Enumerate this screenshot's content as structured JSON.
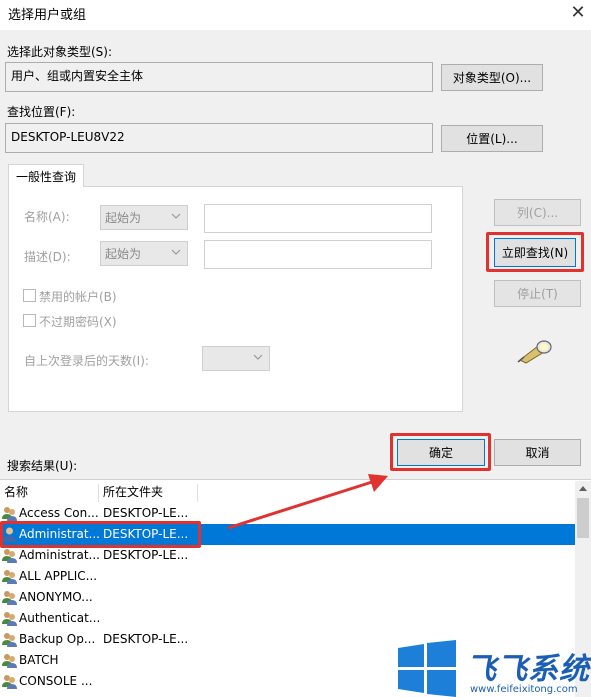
{
  "window": {
    "title": "选择用户或组",
    "close_glyph": "✕"
  },
  "object_type": {
    "label": "选择此对象类型(S):",
    "value": "用户、组或内置安全主体",
    "button": "对象类型(O)..."
  },
  "location": {
    "label": "查找位置(F):",
    "value": "DESKTOP-LEU8V22",
    "button": "位置(L)..."
  },
  "general_query": {
    "tab": "一般性查询",
    "name_label": "名称(A):",
    "name_combo": "起始为",
    "desc_label": "描述(D):",
    "desc_combo": "起始为",
    "disabled_accounts": "禁用的帐户(B)",
    "non_expiring_pwd": "不过期密码(X)",
    "days_since_logon": "自上次登录后的天数(I):"
  },
  "side_buttons": {
    "columns": "列(C)...",
    "find_now": "立即查找(N)",
    "stop": "停止(T)"
  },
  "dialog_buttons": {
    "ok": "确定",
    "cancel": "取消"
  },
  "results": {
    "label": "搜索结果(U):",
    "headers": [
      "名称",
      "所在文件夹"
    ],
    "rows": [
      {
        "name": "Access Con...",
        "folder": "DESKTOP-LE...",
        "icon": "group-icon"
      },
      {
        "name": "Administrat...",
        "folder": "DESKTOP-LE...",
        "icon": "user-icon",
        "selected": true
      },
      {
        "name": "Administrat...",
        "folder": "DESKTOP-LE...",
        "icon": "group-icon"
      },
      {
        "name": "ALL APPLIC...",
        "folder": "",
        "icon": "group-icon"
      },
      {
        "name": "ANONYMO...",
        "folder": "",
        "icon": "group-icon"
      },
      {
        "name": "Authenticat...",
        "folder": "",
        "icon": "group-icon"
      },
      {
        "name": "Backup Op...",
        "folder": "DESKTOP-LE...",
        "icon": "group-icon"
      },
      {
        "name": "BATCH",
        "folder": "",
        "icon": "group-icon"
      },
      {
        "name": "CONSOLE ...",
        "folder": "",
        "icon": "group-icon"
      }
    ]
  },
  "watermark": {
    "brand": "飞飞系统",
    "url": "www.feifeixitong.com"
  },
  "colors": {
    "selection": "#0078d7",
    "highlight_box": "#e0322e",
    "arrow": "#e0322e"
  }
}
